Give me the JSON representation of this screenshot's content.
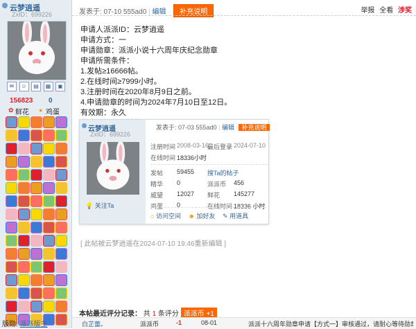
{
  "author": {
    "name": "云梦逍遥",
    "uid": "ZxID：699226"
  },
  "stats": {
    "flowers_count": "156823",
    "flowers_label": "鲜花",
    "eggs_count": "0",
    "eggs_label": "鸡蛋"
  },
  "footer_left": {
    "label": "版勋:",
    "link": "派派版主"
  },
  "post_meta": {
    "published": "发表于: 07-10",
    "device": "555ad0",
    "edit": "编辑",
    "supplement": "补充说明"
  },
  "top_actions": {
    "report": "举报",
    "show_all": "全看",
    "clear": "涉奖"
  },
  "post_lines": [
    "申请人派派ID：云梦逍遥",
    "申请方式：一",
    "申请勋章：派派小说十六周年庆纪念勋章",
    "申请所需条件：",
    "1.发帖≥16666帖。",
    "2.在线时间≥7999小时。",
    "3.注册时间在2020年8月9日之前。",
    "4.申请勋章的时间为2024年7月10日至12日。",
    "有效期：永久",
    "备注：相关资料截图。"
  ],
  "card": {
    "name": "云梦逍遥",
    "uid": "ZxID：699226",
    "published": "发表于: 07-03",
    "device": "555ad0",
    "edit": "编辑",
    "supplement": "补充说明",
    "reg_label": "注册时间",
    "reg_value": "2008-03-16",
    "last_label": "最后登录",
    "last_value": "2024-07-10",
    "online_label": "在线时间",
    "online_value": "18336小时",
    "rows": [
      {
        "l1": "发帖",
        "v1": "59455",
        "l2": "搜Ta的帖子",
        "v2": ""
      },
      {
        "l1": "精华",
        "v1": "0",
        "l2": "派派币",
        "v2": "456"
      },
      {
        "l1": "威望",
        "v1": "12027",
        "l2": "鲜花",
        "v2": "145277"
      },
      {
        "l1": "鸡蛋",
        "v1": "0",
        "l2": "在线时间",
        "v2": "18336 小时"
      }
    ],
    "follow": "关注Ta",
    "visit": "访问空间",
    "add_friend": "加好友",
    "use_item": "用道具"
  },
  "edit_note": "[ 此帖被云梦逍遥在2024-07-10 19:46重新编辑 ]",
  "rating": {
    "title": "本帖最近评分记录：",
    "count_prefix": "共",
    "count": "1",
    "count_suffix": "条评分",
    "badge": "派派币 +1",
    "row": {
      "user": "白芷蕾。",
      "type": "派派币",
      "value": "-1",
      "date": "08-01",
      "reason": "派派十六周年勋章申请【方式一】审核通过，请耐心等待勋章"
    }
  },
  "colors": {
    "accent": "#ff6600",
    "link": "#336699",
    "sidebar": "#e5edf2"
  }
}
